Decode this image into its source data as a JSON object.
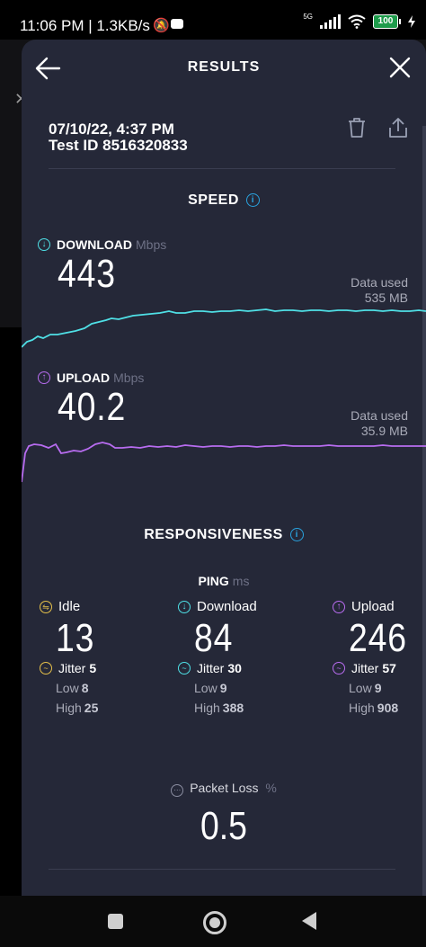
{
  "status_bar": {
    "time": "11:06 PM | 1.3KB/s",
    "network": "5G",
    "battery": "100"
  },
  "header": {
    "title": "RESULTS"
  },
  "test": {
    "date": "07/10/22, 4:37 PM",
    "test_id": "Test ID 8516320833"
  },
  "speed": {
    "section_title": "SPEED",
    "download": {
      "label": "DOWNLOAD",
      "unit": "Mbps",
      "value": "443",
      "data_used_label": "Data used",
      "data_used_value": "535 MB",
      "color": "#4fe0e6"
    },
    "upload": {
      "label": "UPLOAD",
      "unit": "Mbps",
      "value": "40.2",
      "data_used_label": "Data used",
      "data_used_value": "35.9 MB",
      "color": "#b86cf0"
    }
  },
  "responsiveness": {
    "section_title": "RESPONSIVENESS",
    "ping_label": "PING",
    "ping_unit": "ms",
    "idle": {
      "label": "Idle",
      "value": "13",
      "jitter_label": "Jitter",
      "jitter_value": "5",
      "low_label": "Low",
      "low_value": "8",
      "high_label": "High",
      "high_value": "25",
      "color": "#e6c14a"
    },
    "download": {
      "label": "Download",
      "value": "84",
      "jitter_label": "Jitter",
      "jitter_value": "30",
      "low_label": "Low",
      "low_value": "9",
      "high_label": "High",
      "high_value": "388",
      "color": "#4fe0e6"
    },
    "upload": {
      "label": "Upload",
      "value": "246",
      "jitter_label": "Jitter",
      "jitter_value": "57",
      "low_label": "Low",
      "low_value": "9",
      "high_label": "High",
      "high_value": "908",
      "color": "#b86cf0"
    }
  },
  "packet_loss": {
    "label": "Packet Loss",
    "unit": "%",
    "value": "0.5"
  }
}
